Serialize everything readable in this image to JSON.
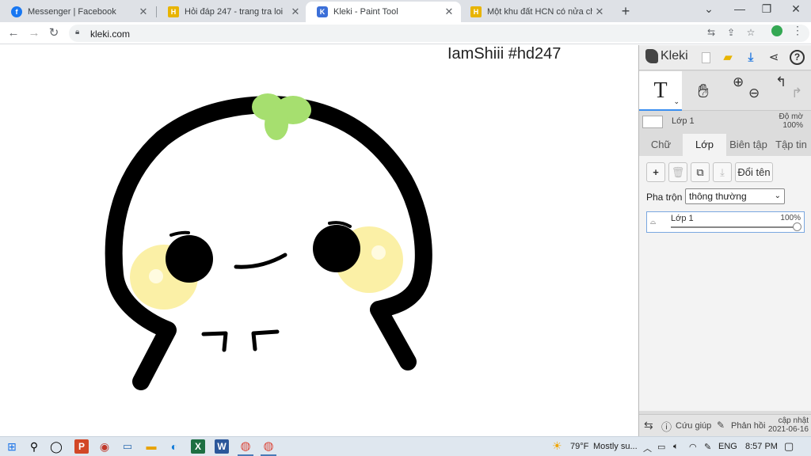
{
  "browser": {
    "tabs": [
      {
        "title": "Messenger | Facebook",
        "favicon": "facebook-icon",
        "color": "#1877f2",
        "glyph": "f"
      },
      {
        "title": "Hỏi đáp 247 - trang tra loi",
        "favicon": "hoidap-icon",
        "color": "#e8b400",
        "glyph": "H"
      },
      {
        "title": "Kleki - Paint Tool",
        "favicon": "kleki-icon",
        "color": "#3b6fd8",
        "glyph": "K"
      },
      {
        "title": "Một khu đất HCN có nửa chu vi l",
        "favicon": "hoidap-icon",
        "color": "#e8b400",
        "glyph": "H"
      }
    ],
    "new_tab_label": "+",
    "url": "kleki.com"
  },
  "canvas": {
    "text": "IamShiii #hd247"
  },
  "kleki": {
    "logo": "Kleki",
    "top_layer_name": "Lớp 1",
    "top_opacity_label": "Độ mờ",
    "top_opacity_value": "100%",
    "tabs": [
      "Chữ",
      "Lớp",
      "Biên tập",
      "Tập tin"
    ],
    "active_tab": "Lớp",
    "buttons": {
      "add": "+",
      "rename": "Đổi tên"
    },
    "blend_label": "Pha trộn",
    "blend_value": "thông thường",
    "layers": [
      {
        "name": "Lớp 1",
        "opacity": "100%",
        "opacity_fraction": 1.0
      }
    ],
    "footer": {
      "help": "Cứu giúp",
      "feedback": "Phản hồi",
      "update_label": "cập nhật",
      "update_date": "2021-06-16"
    },
    "accent": "#3b8ff0"
  },
  "taskbar": {
    "weather": "79°F",
    "weather_text": "Mostly su...",
    "language": "ENG",
    "time": "8:57 PM"
  }
}
